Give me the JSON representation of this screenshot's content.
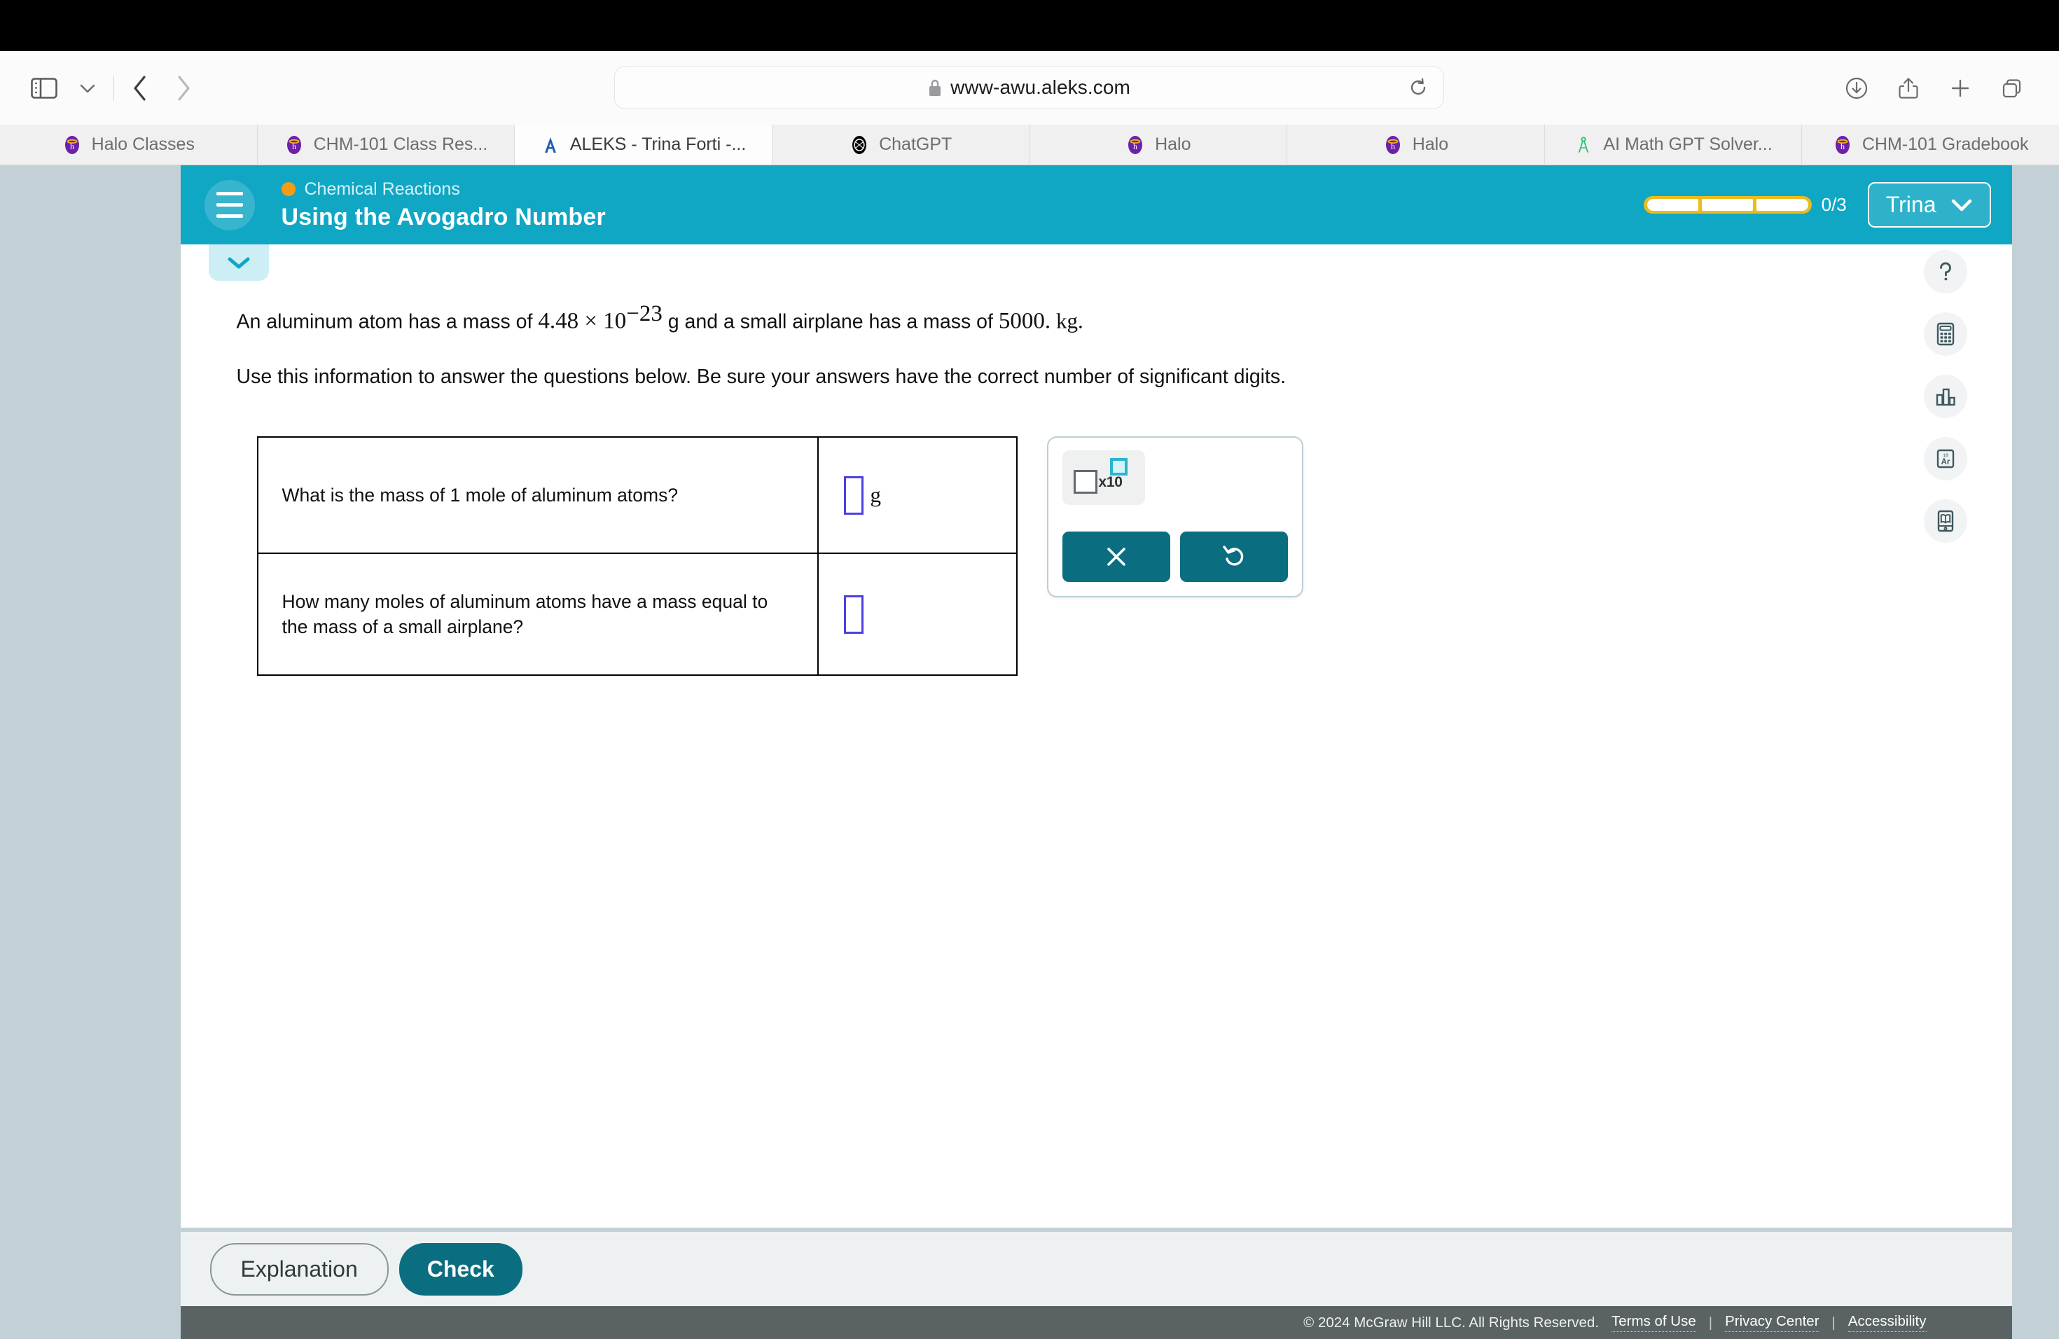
{
  "browser": {
    "url": "www-awu.aleks.com",
    "lock_icon": "lock-icon",
    "reload_icon": "reload-icon",
    "sidebar_toggle_icon": "sidebar-toggle-icon",
    "chevron_icon": "chevron-down-icon",
    "back_icon": "back-arrow-icon",
    "forward_icon": "forward-arrow-icon",
    "downloads_icon": "downloads-icon",
    "share_icon": "share-icon",
    "newtab_icon": "plus-icon",
    "tabs_overview_icon": "tab-overview-icon",
    "tabs": [
      {
        "label": "Halo Classes",
        "favicon": "halo-icon",
        "active": false
      },
      {
        "label": "CHM-101 Class Res...",
        "favicon": "halo-icon",
        "active": false
      },
      {
        "label": "ALEKS - Trina Forti -...",
        "favicon": "aleks-icon",
        "active": true
      },
      {
        "label": "ChatGPT",
        "favicon": "chatgpt-icon",
        "active": false
      },
      {
        "label": "Halo",
        "favicon": "halo-icon",
        "active": false
      },
      {
        "label": "Halo",
        "favicon": "halo-icon",
        "active": false
      },
      {
        "label": "AI Math GPT Solver...",
        "favicon": "compass-icon",
        "active": false
      },
      {
        "label": "CHM-101 Gradebook",
        "favicon": "halo-icon",
        "active": false
      }
    ]
  },
  "header": {
    "menu_icon": "hamburger-menu-icon",
    "breadcrumb": "Chemical Reactions",
    "breadcrumb_dot_color": "#f59c16",
    "title": "Using the Avogadro Number",
    "progress_text": "0/3",
    "progress_segments": 3,
    "progress_filled": 0,
    "progress_color": "#ecbc1d",
    "user_name": "Trina",
    "user_chevron_icon": "chevron-down-icon",
    "collapse_icon": "chevron-down-icon",
    "bar_color": "#10a7c4"
  },
  "problem": {
    "intro_prefix": "An aluminum atom has a mass of ",
    "intro_mass_mantissa": "4.48 × 10",
    "intro_mass_exponent": "−23",
    "intro_mid": " g and a small airplane has a mass of ",
    "intro_airplane_mass": "5000.",
    "intro_airplane_unit": "kg.",
    "instruction": "Use this information to answer the questions below. Be sure your answers have the correct number of significant digits."
  },
  "questions": [
    {
      "text": "What is the mass of 1 mole of aluminum atoms?",
      "answer_value": "",
      "unit": "g"
    },
    {
      "text": "How many moles of aluminum atoms have a mass equal to the mass of a small airplane?",
      "answer_value": "",
      "unit": ""
    }
  ],
  "toolpanel": {
    "sci_notation_label": "x10",
    "sci_notation_icon": "scientific-notation-icon",
    "clear_icon": "close-x-icon",
    "undo_icon": "undo-icon",
    "button_color": "#0a6e80"
  },
  "rightrail": [
    {
      "name": "help-icon",
      "tooltip": "Help"
    },
    {
      "name": "calculator-icon",
      "tooltip": "Calculator"
    },
    {
      "name": "bar-chart-icon",
      "tooltip": "Data"
    },
    {
      "name": "periodic-table-icon",
      "tooltip": "Periodic Table",
      "element_symbol": "Ar",
      "element_number": "18"
    },
    {
      "name": "reference-book-icon",
      "tooltip": "Reference"
    }
  ],
  "actions": {
    "explanation_label": "Explanation",
    "check_label": "Check",
    "check_color": "#0a6e80"
  },
  "footer": {
    "copyright": "© 2024 McGraw Hill LLC. All Rights Reserved.",
    "links": [
      "Terms of Use",
      "Privacy Center",
      "Accessibility"
    ],
    "separator": "|"
  }
}
